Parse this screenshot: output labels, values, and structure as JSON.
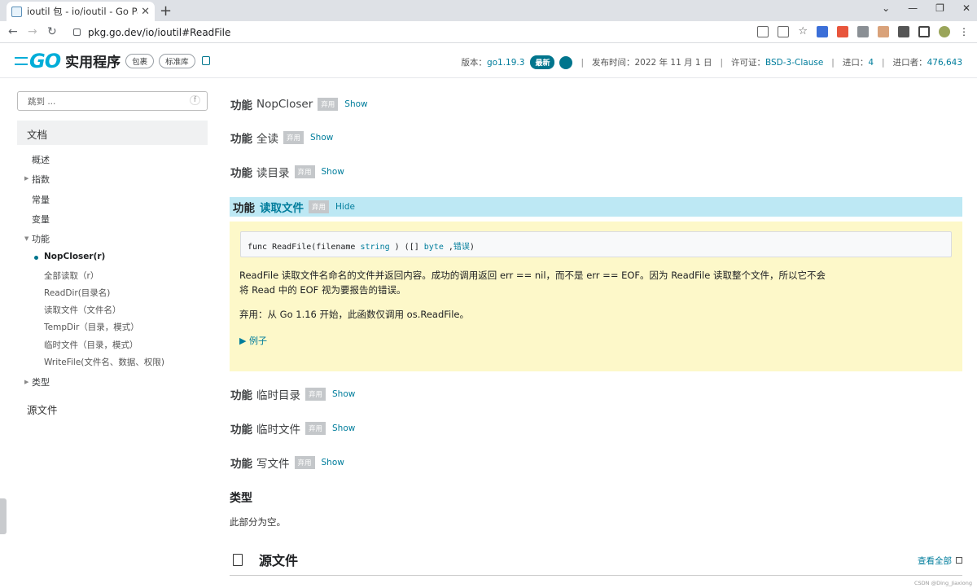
{
  "browser": {
    "tab_title": "ioutil 包 - io/ioutil - Go Packag",
    "url": "pkg.go.dev/io/ioutil#ReadFile",
    "window_controls": [
      "⌄",
      "—",
      "❐",
      "✕"
    ]
  },
  "header": {
    "site_title": "实用程序",
    "pill_package": "包裹",
    "pill_stdlib": "标准库",
    "version_label": "版本：",
    "version": "go1.19.3",
    "latest_badge": "最新",
    "published_label": "发布时间：2022 年 11 月 1 日",
    "license_label": "许可证：",
    "license": "BSD-3-Clause",
    "imports_label": "进口：",
    "imports": "4",
    "importers_label": "进口者：",
    "importers": "476,643"
  },
  "sidebar": {
    "jump_placeholder": "跳到 ...",
    "jump_key": "f",
    "docs_label": "文档",
    "items": {
      "overview": "概述",
      "index": "指数",
      "constants": "常量",
      "variables": "变量",
      "functions": "功能",
      "types": "类型"
    },
    "function_items": [
      "NopCloser(r)",
      "全部读取（r）",
      "ReadDir(目录名)",
      "读取文件（文件名）",
      "TempDir（目录，模式）",
      "临时文件（目录，模式）",
      "WriteFile(文件名、数据、权限)"
    ],
    "source_files": "源文件"
  },
  "main": {
    "func_kw": "功能",
    "deprecated": "弃用",
    "show": "Show",
    "hide": "Hide",
    "functions_before": [
      "NopCloser",
      "全读",
      "读目录"
    ],
    "expanded": {
      "name": "读取文件",
      "signature": {
        "prefix": "func ReadFile(filename ",
        "type1": "string",
        "mid": " ) ([] ",
        "type2": "byte",
        "sep": " ,",
        "err": "错误",
        "suffix": ")"
      },
      "description_line1": "ReadFile 读取文件名命名的文件并返回内容。成功的调用返回 err == nil，而不是 err == EOF。因为 ReadFile 读取整个文件，所以它不会",
      "description_line2": "将 Read 中的 EOF 视为要报告的错误。",
      "deprecation_note": "弃用：从 Go 1.16 开始，此函数仅调用 os.ReadFile。",
      "example": "▶ 例子"
    },
    "functions_after": [
      "临时目录",
      "临时文件",
      "写文件"
    ],
    "types_heading": "类型",
    "types_empty": "此部分为空。",
    "source_heading": "源文件",
    "view_all": "查看全部"
  },
  "watermark": "CSDN @Ding_Jiaxiong",
  "colors": {
    "accent": "#007d9c",
    "badge": "#00758d",
    "highlight_head": "#bde8f4",
    "highlight_body": "#fdf8c9"
  }
}
